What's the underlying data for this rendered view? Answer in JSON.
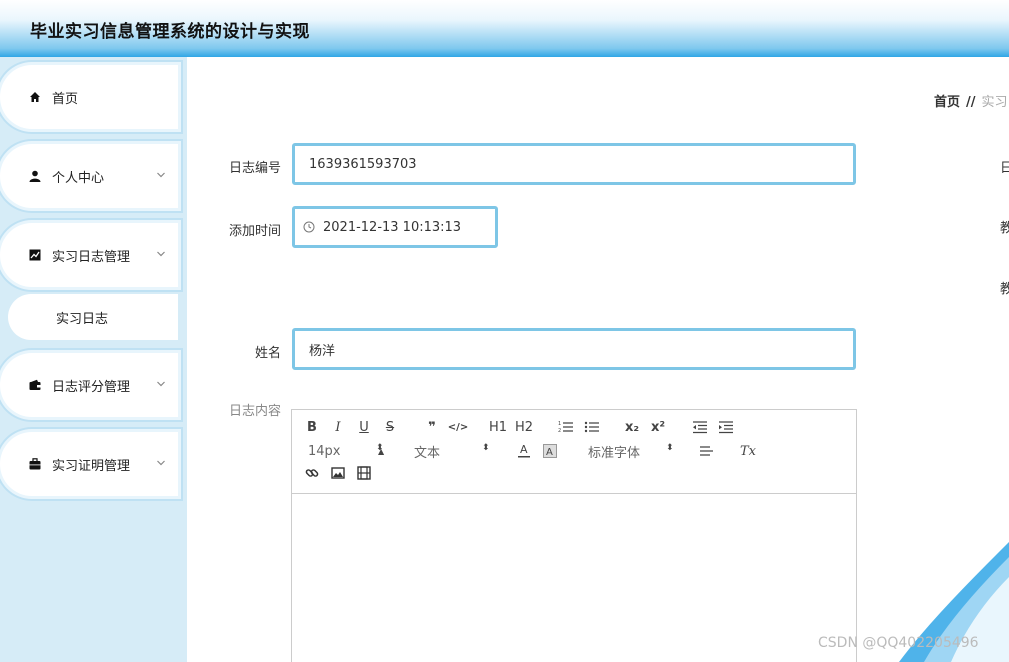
{
  "app": {
    "title": "毕业实习信息管理系统的设计与实现"
  },
  "sidebar": {
    "items": [
      {
        "label": "首页",
        "icon": "home-icon"
      },
      {
        "label": "个人中心",
        "icon": "user-icon"
      },
      {
        "label": "实习日志管理",
        "icon": "chart-icon"
      },
      {
        "label": "实习日志",
        "icon": ""
      },
      {
        "label": "日志评分管理",
        "icon": "wallet-icon"
      },
      {
        "label": "实习证明管理",
        "icon": "briefcase-icon"
      }
    ]
  },
  "breadcrumb": {
    "home": "首页",
    "separator": "//",
    "current": "实习"
  },
  "form": {
    "log_no_label": "日志编号",
    "log_no_value": "1639361593703",
    "add_time_label": "添加时间",
    "add_time_value": "2021-12-13 10:13:13",
    "name_label": "姓名",
    "name_value": "杨洋",
    "content_label": "日志内容"
  },
  "right_column": {
    "labels": [
      "日",
      "教",
      "教"
    ]
  },
  "editor": {
    "font_size": "14px",
    "text_style": "文本",
    "font_family": "标准字体",
    "buttons": [
      "B",
      "I",
      "U",
      "S",
      "❞",
      "</>",
      "H1",
      "H2",
      "x₂",
      "x²",
      "Tx"
    ]
  },
  "watermark": "CSDN @QQ402205496",
  "colors": {
    "accent": "#7ec6e6",
    "header_blue": "#2fa6e6",
    "sidebar_bg": "#d6ecf7"
  }
}
